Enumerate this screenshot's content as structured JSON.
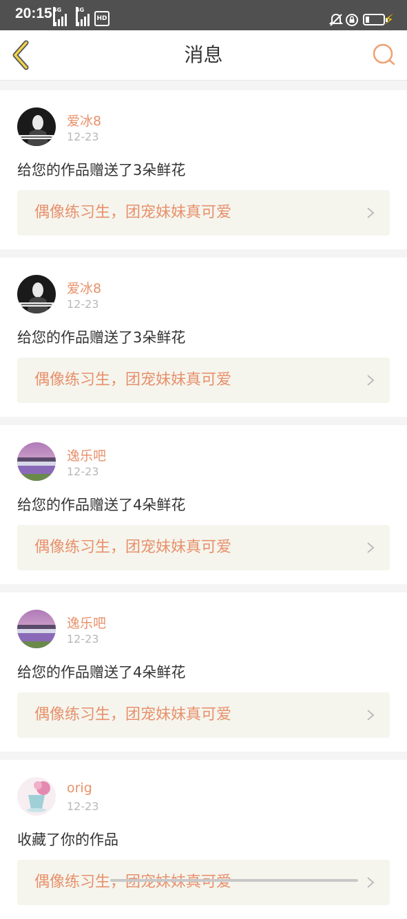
{
  "status_bar": {
    "time": "20:15",
    "sim1_type": "4G",
    "sim2_type": "4G",
    "hd_label": "HD",
    "icons": [
      "signal-icon",
      "signal-icon",
      "hd-icon",
      "alarm-off-icon",
      "lock-rotation-icon",
      "battery-icon",
      "charging-icon"
    ],
    "colors": {
      "background": "#505050",
      "charging": "#f2c200"
    }
  },
  "header": {
    "title": "消息",
    "back_icon": "chevron-left-icon",
    "search_icon": "search-icon",
    "colors": {
      "back": "#f0d34a",
      "search": "#f0a070"
    }
  },
  "messages": [
    {
      "user": "爱冰8",
      "date": "12-23",
      "action": "给您的作品赠送了3朵鲜花",
      "work_title": "偶像练习生，团宠妹妹真可爱",
      "avatar": "portrait-avatar"
    },
    {
      "user": "爱冰8",
      "date": "12-23",
      "action": "给您的作品赠送了3朵鲜花",
      "work_title": "偶像练习生，团宠妹妹真可爱",
      "avatar": "portrait-avatar"
    },
    {
      "user": "逸乐吧",
      "date": "12-23",
      "action": "给您的作品赠送了4朵鲜花",
      "work_title": "偶像练习生，团宠妹妹真可爱",
      "avatar": "lavender-field-avatar"
    },
    {
      "user": "逸乐吧",
      "date": "12-23",
      "action": "给您的作品赠送了4朵鲜花",
      "work_title": "偶像练习生，团宠妹妹真可爱",
      "avatar": "lavender-field-avatar"
    },
    {
      "user": "orig",
      "date": "12-23",
      "action": "收藏了你的作品",
      "work_title": "偶像练习生，团宠妹妹真可爱",
      "avatar": "flower-cup-avatar"
    }
  ],
  "colors": {
    "accent": "#e8906a",
    "link_bg": "#f5f5ee",
    "page_bg": "#f4f4f4"
  }
}
